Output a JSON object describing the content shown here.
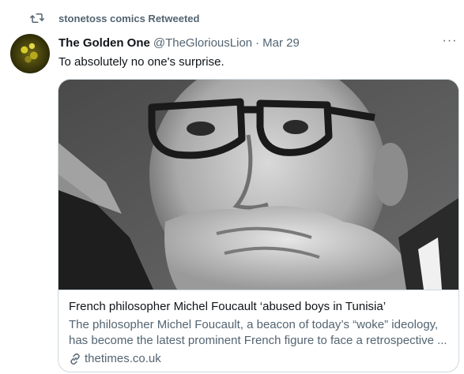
{
  "retweet": {
    "label": "stonetoss comics Retweeted"
  },
  "author": {
    "display_name": "The Golden One",
    "handle": "@TheGloriousLion",
    "separator": "·",
    "time": "Mar 29"
  },
  "more_label": "···",
  "tweet": {
    "text": "To absolutely no one's surprise."
  },
  "card": {
    "title": "French philosopher Michel Foucault ‘abused boys in Tunisia’",
    "description_line1": "The philosopher Michel Foucault, a beacon of today’s “woke” ideology,",
    "description_line2": "has become the latest prominent French figure to face a retrospective ...",
    "domain": "thetimes.co.uk"
  },
  "icons": {
    "retweet": "retweet-icon",
    "more": "more-icon",
    "link": "link-icon"
  },
  "colors": {
    "text_primary": "#0f1419",
    "text_secondary": "#536471",
    "border": "#cfd9de"
  }
}
